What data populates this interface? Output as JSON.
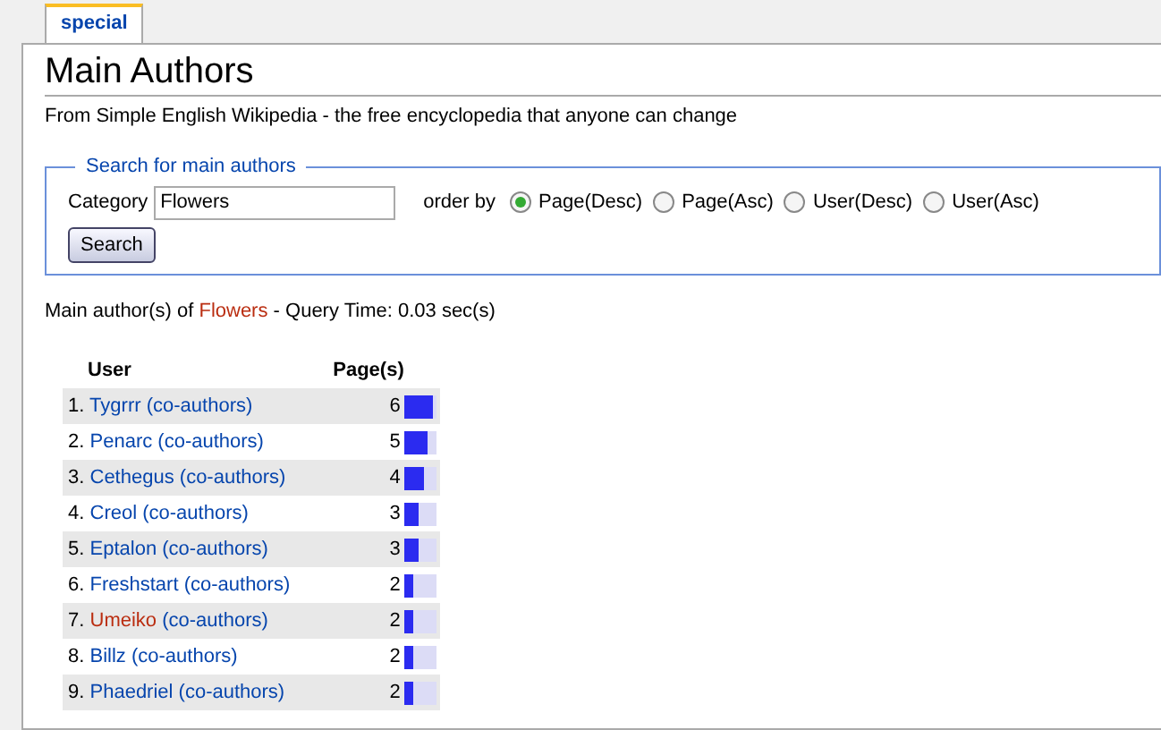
{
  "tab": {
    "label": "special",
    "selected": true
  },
  "heading": "Main Authors",
  "subtitle": "From Simple English Wikipedia - the free encyclopedia that anyone can change",
  "search": {
    "legend": "Search for main authors",
    "category_label": "Category",
    "category_value": "Flowers",
    "order_label": "order by",
    "options": [
      {
        "label": "Page(Desc)",
        "selected": true
      },
      {
        "label": "Page(Asc)",
        "selected": false
      },
      {
        "label": "User(Desc)",
        "selected": false
      },
      {
        "label": "User(Asc)",
        "selected": false
      }
    ],
    "button": "Search"
  },
  "result": {
    "prefix": "Main author(s) of",
    "category": "Flowers",
    "suffix": "- Query Time: 0.03 sec(s)"
  },
  "table": {
    "columns": [
      "User",
      "Page(s)"
    ],
    "rows": [
      {
        "rank": "1.",
        "user": "Tygrrr",
        "missing": false,
        "coauthors": "(co-authors)",
        "pages": "6",
        "level": 0.89
      },
      {
        "rank": "2.",
        "user": "Penarc",
        "missing": false,
        "coauthors": "(co-authors)",
        "pages": "5",
        "level": 0.72
      },
      {
        "rank": "3.",
        "user": "Cethegus",
        "missing": false,
        "coauthors": "(co-authors)",
        "pages": "4",
        "level": 0.61
      },
      {
        "rank": "4.",
        "user": "Creol",
        "missing": false,
        "coauthors": "(co-authors)",
        "pages": "3",
        "level": 0.44
      },
      {
        "rank": "5.",
        "user": "Eptalon",
        "missing": false,
        "coauthors": "(co-authors)",
        "pages": "3",
        "level": 0.44
      },
      {
        "rank": "6.",
        "user": "Freshstart",
        "missing": false,
        "coauthors": "(co-authors)",
        "pages": "2",
        "level": 0.28
      },
      {
        "rank": "7.",
        "user": "Umeiko",
        "missing": true,
        "coauthors": "(co-authors)",
        "pages": "2",
        "level": 0.28
      },
      {
        "rank": "8.",
        "user": "Billz",
        "missing": false,
        "coauthors": "(co-authors)",
        "pages": "2",
        "level": 0.28
      },
      {
        "rank": "9.",
        "user": "Phaedriel",
        "missing": false,
        "coauthors": "(co-authors)",
        "pages": "2",
        "level": 0.28
      }
    ]
  }
}
